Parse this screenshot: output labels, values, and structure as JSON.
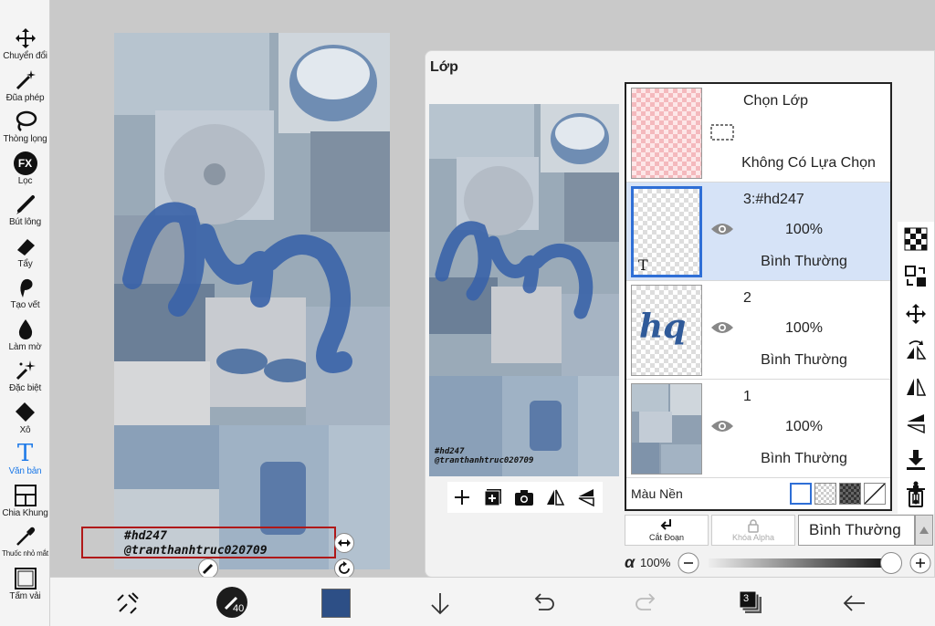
{
  "tools": [
    {
      "label": "Chuyển đổi",
      "icon": "move-icon"
    },
    {
      "label": "Đũa phép",
      "icon": "magic-wand-icon"
    },
    {
      "label": "Thòng lọng",
      "icon": "lasso-icon"
    },
    {
      "label": "Lọc",
      "icon": "fx-filter-icon",
      "glyph": "FX"
    },
    {
      "label": "Bút lông",
      "icon": "brush-icon"
    },
    {
      "label": "Tẩy",
      "icon": "eraser-icon"
    },
    {
      "label": "Tạo vết",
      "icon": "smudge-icon"
    },
    {
      "label": "Làm mờ",
      "icon": "blur-icon"
    },
    {
      "label": "Đặc biệt",
      "icon": "sparkle-icon"
    },
    {
      "label": "Xô",
      "icon": "bucket-icon"
    },
    {
      "label": "Văn bản",
      "icon": "text-tool-icon",
      "glyph": "T",
      "active": true
    },
    {
      "label": "Chia Khung",
      "icon": "frame-divider-icon"
    },
    {
      "label": "Thuốc nhỏ mắt",
      "icon": "eyedropper-icon"
    },
    {
      "label": "Tấm vải",
      "icon": "canvas-icon"
    }
  ],
  "canvas": {
    "art_text": "hq",
    "text_layer_line1": "#hd247",
    "text_layer_line2": "@tranthanhtruc020709"
  },
  "panel": {
    "title": "Lớp",
    "selection_layer": {
      "name": "Chọn Lớp",
      "status": "Không Có Lựa Chọn"
    },
    "layers": [
      {
        "name": "3:#hd247",
        "opacity": "100%",
        "mode": "Bình Thường",
        "selected": true,
        "thumb_glyph": "T"
      },
      {
        "name": "2",
        "opacity": "100%",
        "mode": "Bình Thường",
        "selected": false,
        "thumb_glyph": "hq"
      },
      {
        "name": "1",
        "opacity": "100%",
        "mode": "Bình Thường",
        "selected": false,
        "thumb_glyph": ""
      }
    ],
    "background_label": "Màu Nền",
    "clipping_label": "Cắt Đoạn",
    "alpha_lock_label": "Khóa Alpha",
    "blend_mode": "Bình Thường",
    "alpha_symbol": "α",
    "alpha_value": "100%",
    "alpha_fraction": 1.0,
    "preview_text_line1": "#hd247",
    "preview_text_line2": "@tranthanhtruc020709"
  },
  "bottom": {
    "brush_size": "40",
    "layer_count": "3",
    "current_color": "#2d4f86"
  },
  "colors": {
    "accent": "#1e7ae8",
    "selection_border": "#2f6fd6",
    "textbox_border": "#b01818",
    "art_blue": "#3a63a8"
  }
}
